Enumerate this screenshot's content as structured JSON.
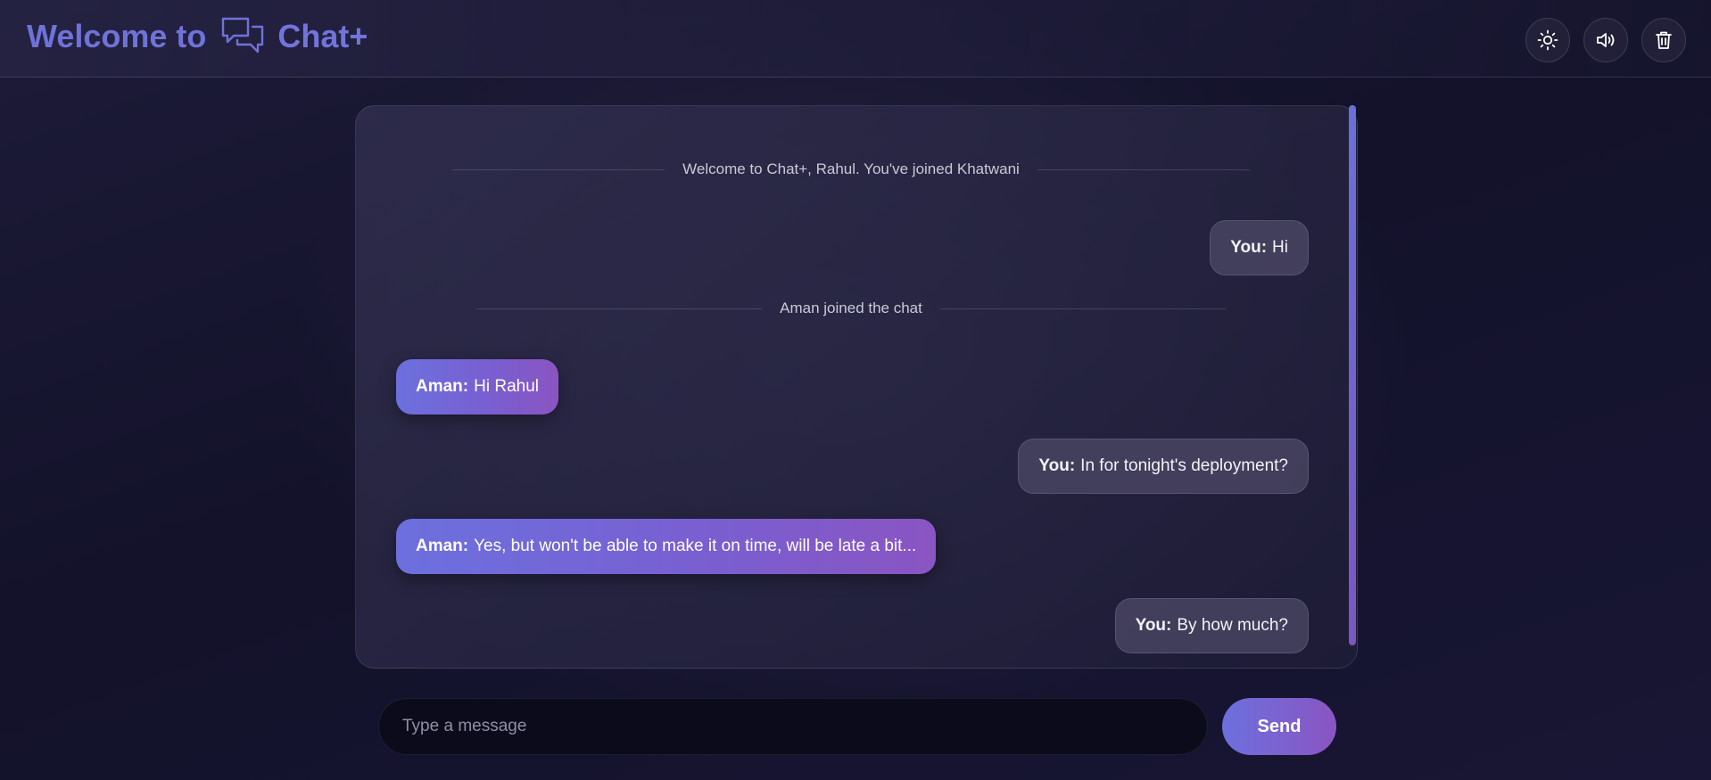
{
  "header": {
    "welcome_text": "Welcome to",
    "app_name": "Chat+",
    "icons": {
      "brand": "chat-bubbles-icon",
      "theme": "sun-icon",
      "sound": "speaker-icon",
      "clear": "trash-icon"
    }
  },
  "chat": {
    "system_messages": [
      {
        "text": "Welcome to Chat+, Rahul. You've joined Khatwani"
      },
      {
        "text": "Aman joined the chat"
      }
    ],
    "messages": [
      {
        "sender": "You:",
        "text": "Hi",
        "mine": true
      },
      {
        "sender": "Aman:",
        "text": "Hi Rahul",
        "mine": false
      },
      {
        "sender": "You:",
        "text": "In for tonight's deployment?",
        "mine": true
      },
      {
        "sender": "Aman:",
        "text": "Yes, but won't be able to make it on time, will be late a bit...",
        "mine": false
      },
      {
        "sender": "You:",
        "text": "By how much?",
        "mine": true
      }
    ]
  },
  "composer": {
    "placeholder": "Type a message",
    "value": "",
    "send_label": "Send"
  },
  "colors": {
    "accent": "#6c70de",
    "accent_end": "#8a55c2",
    "background": "#13122a"
  }
}
